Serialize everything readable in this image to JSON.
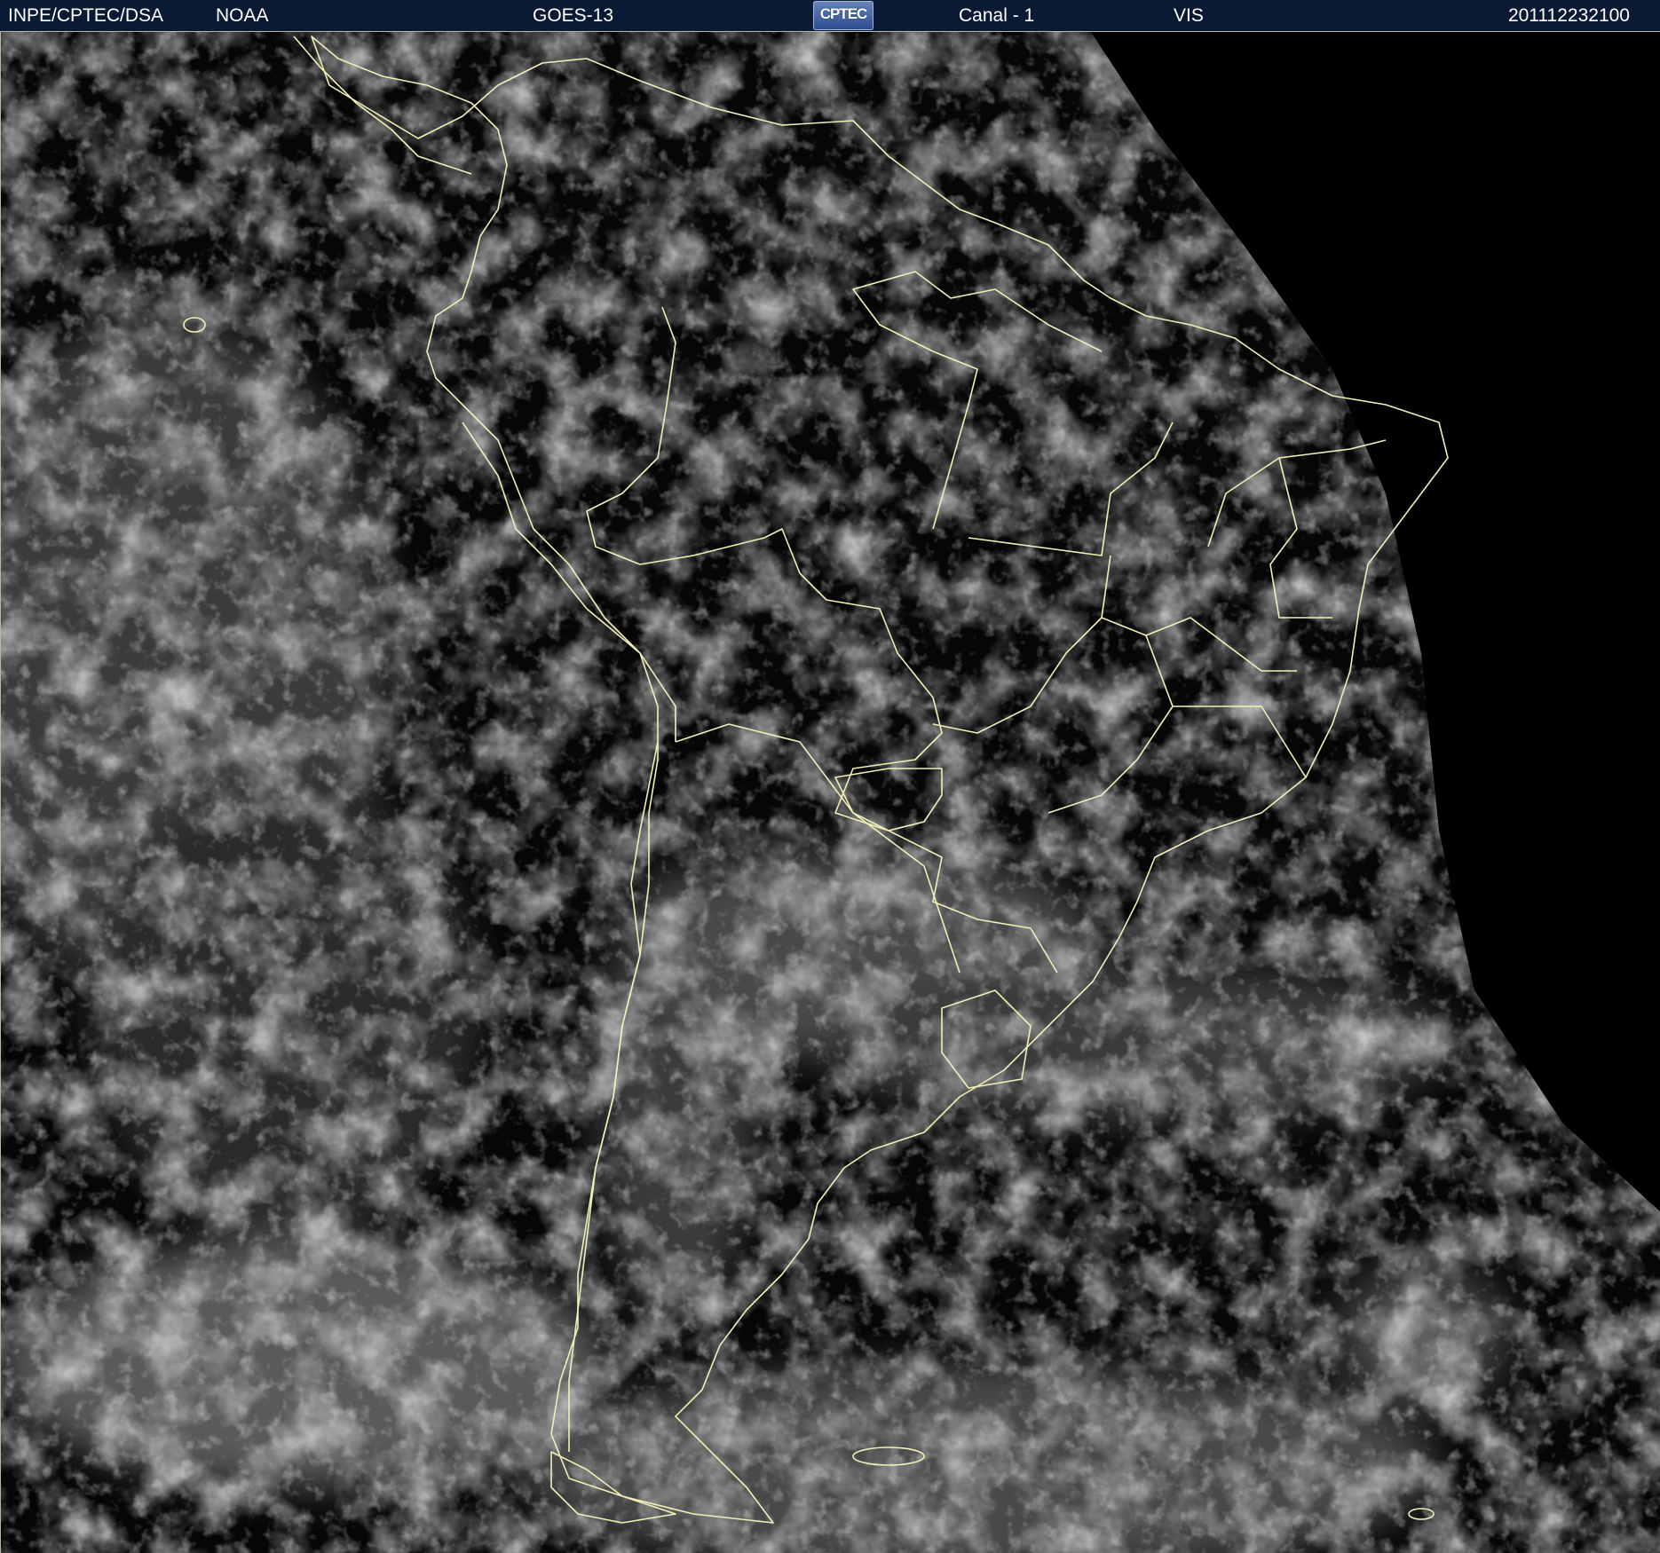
{
  "header": {
    "source": "INPE/CPTEC/DSA",
    "agency": "NOAA",
    "satellite": "GOES-13",
    "logo_text": "CPTEC",
    "channel": "Canal - 1",
    "band": "VIS",
    "timestamp": "201112232100"
  },
  "colors": {
    "header_background": "#0a1a35",
    "header_text": "#ffffff",
    "border_lines": "#f2f0b8",
    "space_background": "#000000"
  }
}
